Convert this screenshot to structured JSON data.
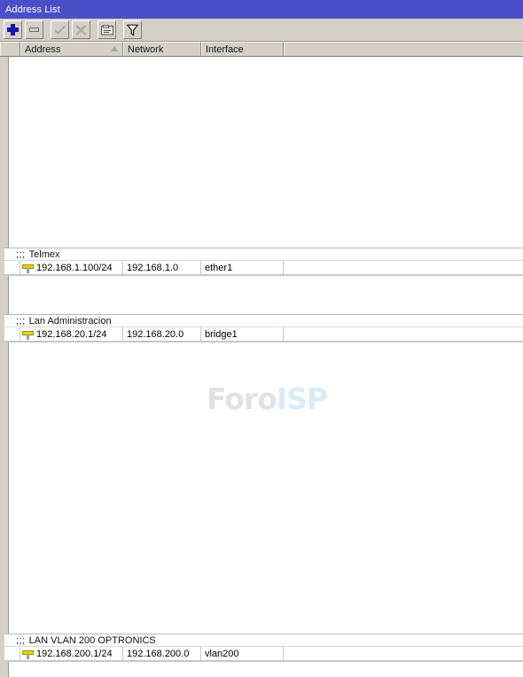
{
  "window": {
    "title": "Address List"
  },
  "toolbar": {
    "buttons": [
      {
        "name": "add-button",
        "icon": "plus-icon",
        "label": "Add",
        "enabled": true
      },
      {
        "name": "remove-button",
        "icon": "minus-icon",
        "label": "Remove",
        "enabled": true
      },
      {
        "name": "enable-button",
        "icon": "check-icon",
        "label": "Enable",
        "enabled": false
      },
      {
        "name": "disable-button",
        "icon": "x-icon",
        "label": "Disable",
        "enabled": false
      },
      {
        "name": "comment-button",
        "icon": "comment-icon",
        "label": "Comment",
        "enabled": true
      },
      {
        "name": "filter-button",
        "icon": "funnel-icon",
        "label": "Filter",
        "enabled": true
      }
    ]
  },
  "table": {
    "columns": [
      {
        "key": "marker",
        "label": ""
      },
      {
        "key": "address",
        "label": "Address",
        "sorted": "asc"
      },
      {
        "key": "network",
        "label": "Network"
      },
      {
        "key": "interface",
        "label": "Interface"
      },
      {
        "key": "spare",
        "label": ""
      }
    ],
    "groups": [
      {
        "comment_prefix": ";;;",
        "comment": "Telmex",
        "rows": [
          {
            "flag": "",
            "icon": "address-icon",
            "address": "192.168.1.100/24",
            "network": "192.168.1.0",
            "interface": "ether1",
            "spare": ""
          }
        ]
      },
      {
        "comment_prefix": ";;;",
        "comment": "Lan Administracion",
        "rows": [
          {
            "flag": "",
            "icon": "address-icon",
            "address": "192.168.20.1/24",
            "network": "192.168.20.0",
            "interface": "bridge1",
            "spare": ""
          }
        ]
      },
      {
        "comment_prefix": ";;;",
        "comment": "LAN VLAN 200 OPTRONICS",
        "rows": [
          {
            "flag": "",
            "icon": "address-icon",
            "address": "192.168.200.1/24",
            "network": "192.168.200.0",
            "interface": "vlan200",
            "spare": ""
          }
        ]
      }
    ]
  },
  "watermark": {
    "part1": "Foro",
    "part2": "ISP"
  },
  "colors": {
    "titlebar": "#4a4fc8",
    "chrome": "#d4d0c8",
    "list_background": "#ffffff",
    "address_icon": "#e8d400",
    "add_icon": "#1515b0",
    "watermark_foro": "#e2e2e2",
    "watermark_isp": "#d8ecf8"
  }
}
